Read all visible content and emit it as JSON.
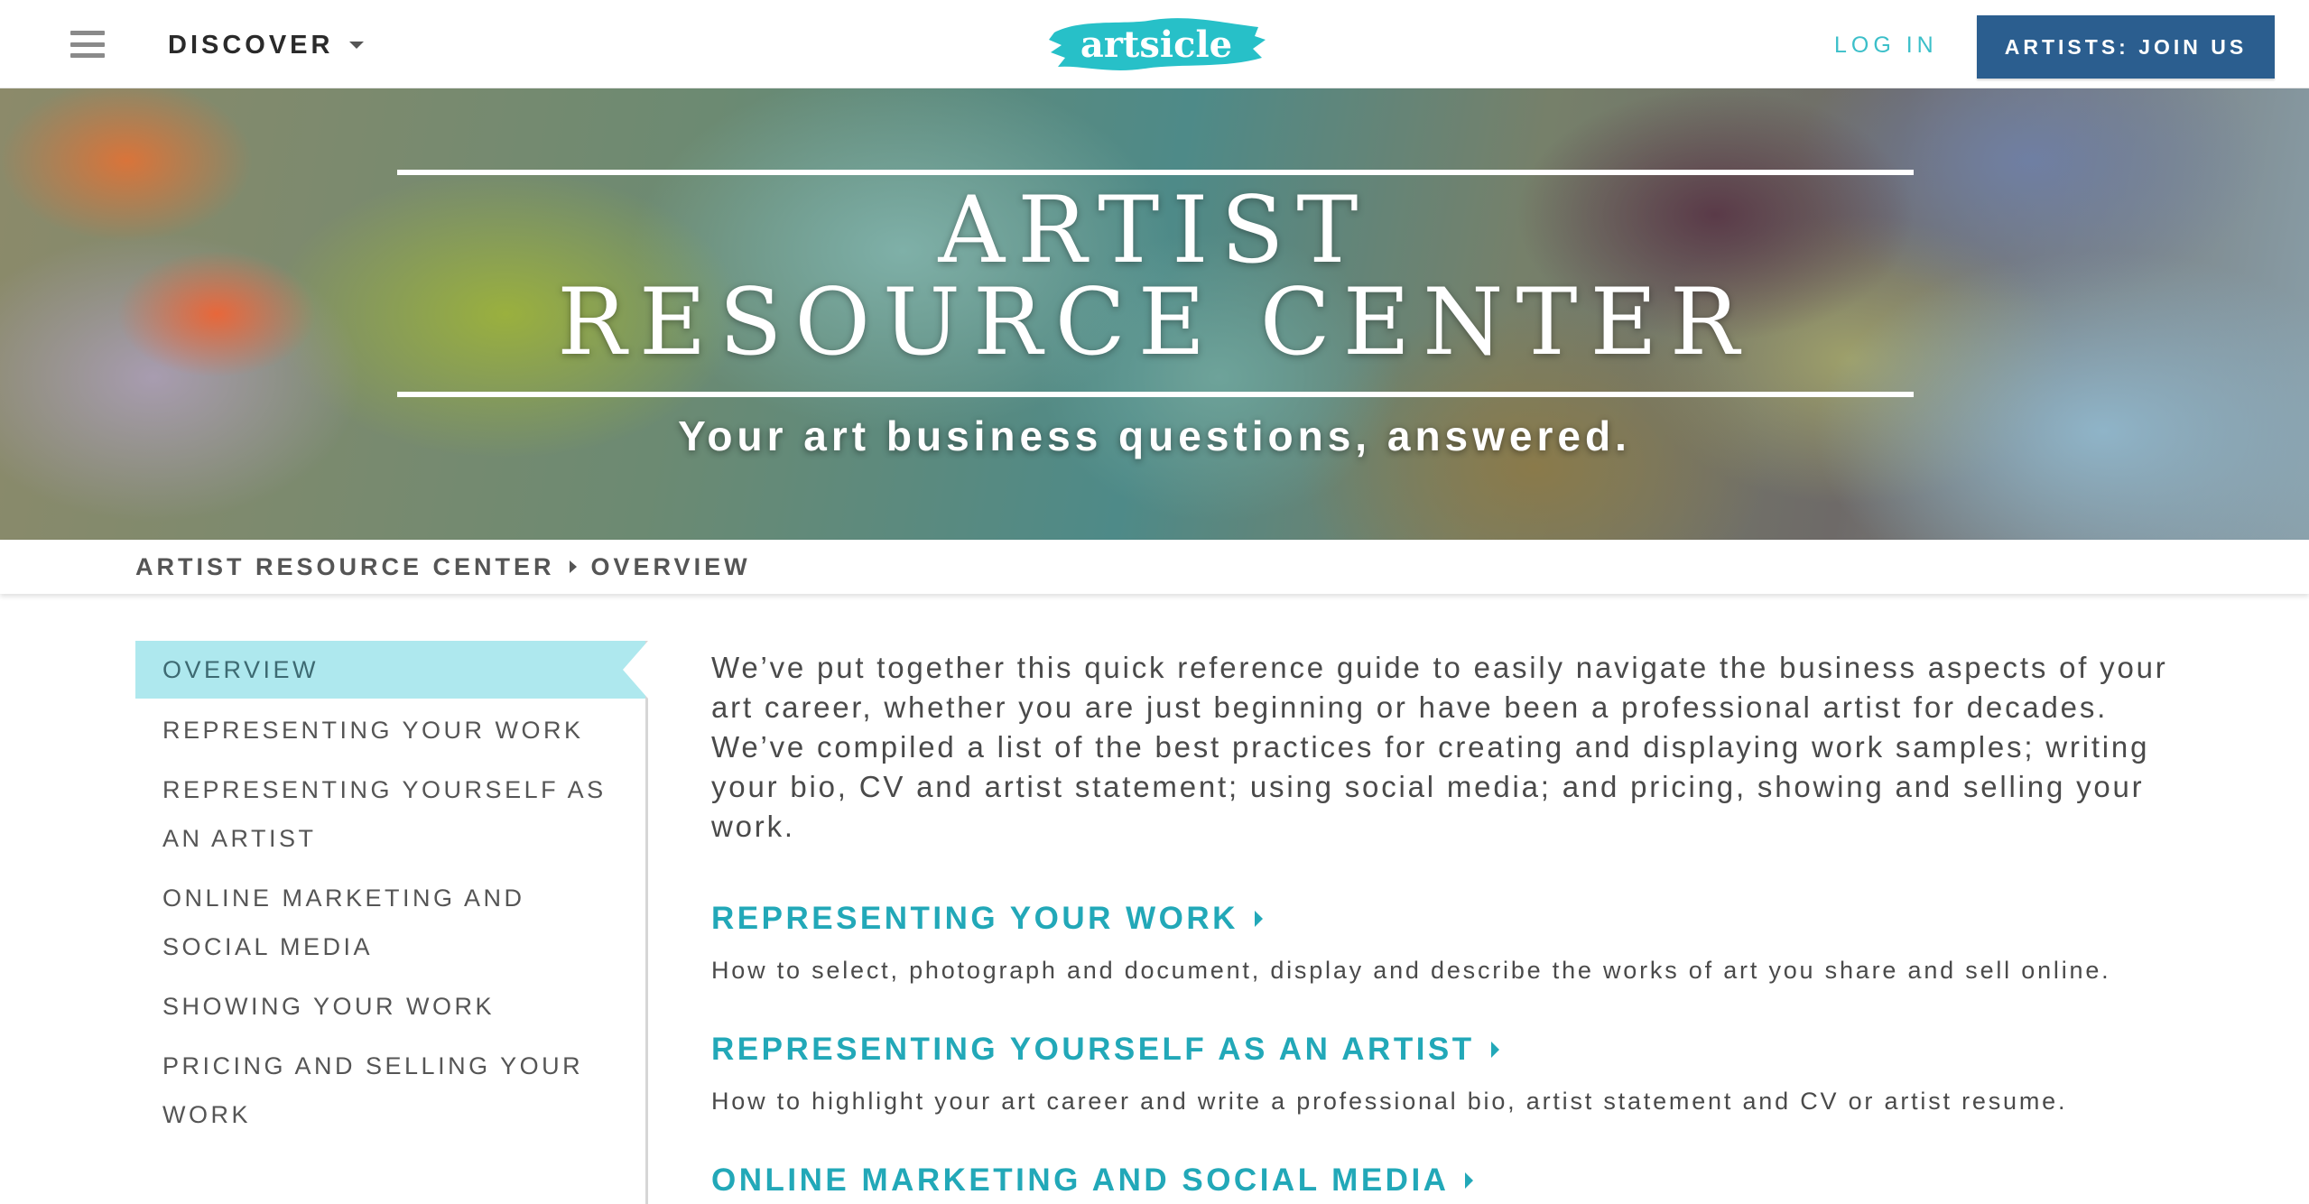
{
  "nav": {
    "discover_label": "DISCOVER",
    "logo_text": "artsicle",
    "login_label": "LOG IN",
    "join_label": "ARTISTS: JOIN US"
  },
  "hero": {
    "title_line1": "ARTIST",
    "title_line2": "RESOURCE CENTER",
    "subtitle": "Your art business questions, answered."
  },
  "breadcrumb": {
    "root": "ARTIST RESOURCE CENTER",
    "current": "OVERVIEW"
  },
  "sidebar": {
    "items": [
      {
        "label": "OVERVIEW",
        "active": true
      },
      {
        "label": "REPRESENTING YOUR WORK"
      },
      {
        "label": "REPRESENTING YOURSELF AS AN ARTIST"
      },
      {
        "label": "ONLINE MARKETING AND SOCIAL MEDIA"
      },
      {
        "label": "SHOWING YOUR WORK"
      },
      {
        "label": "PRICING AND SELLING YOUR WORK"
      }
    ]
  },
  "main": {
    "intro": "We’ve put together this quick reference guide to easily navigate the business aspects of your art career, whether you are just beginning or have been a professional artist for decades. We’ve compiled a list of the best practices for creating and displaying work samples; writing your bio, CV and artist statement; using social media; and pricing, showing and selling your work.",
    "sections": [
      {
        "title": "REPRESENTING YOUR WORK",
        "description": "How to select, photograph and document, display and describe the works of art you share and sell online."
      },
      {
        "title": "REPRESENTING YOURSELF AS AN ARTIST",
        "description": "How to highlight your art career and write a professional bio, artist statement and CV or artist resume."
      },
      {
        "title": "ONLINE MARKETING AND SOCIAL MEDIA",
        "description": ""
      }
    ]
  },
  "colors": {
    "accent_teal": "#22a8b8",
    "join_button": "#2b5e8f",
    "active_sidebar": "#aee8ee",
    "logo_brush": "#27c0c8"
  },
  "icons": [
    "hamburger-menu-icon",
    "chevron-down-icon",
    "chevron-right-icon"
  ]
}
